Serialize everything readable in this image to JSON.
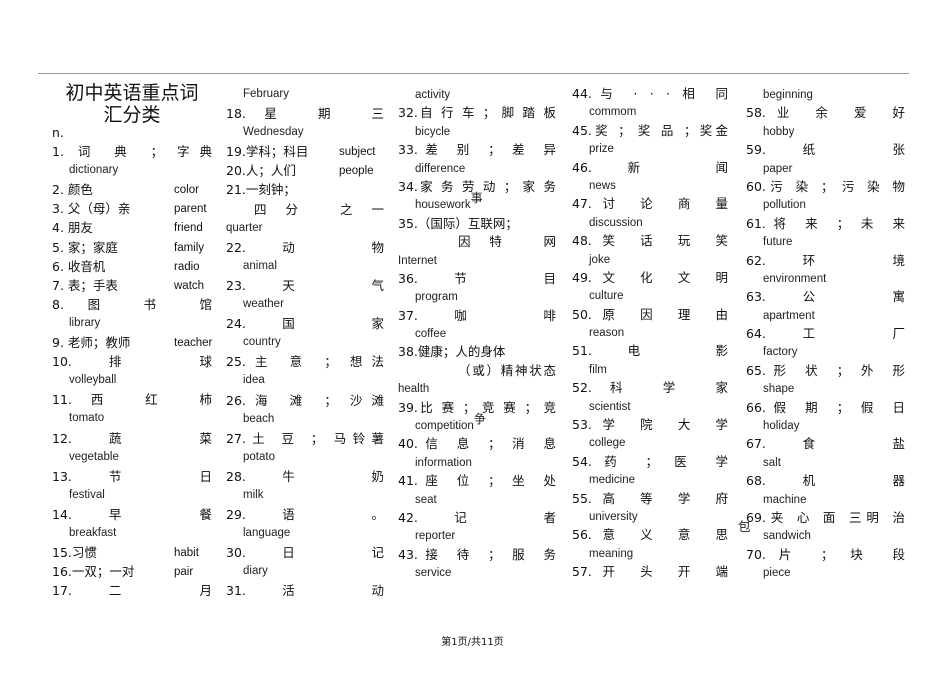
{
  "title": [
    "初中英语重点词",
    "汇分类"
  ],
  "footer": "第1页/共11页",
  "columns": [
    {
      "lines": [
        {
          "k": "l",
          "t": "n."
        },
        {
          "k": "j",
          "t": "1. 词 典 ； 字典"
        },
        {
          "k": "e",
          "t": "dictionary"
        },
        {
          "k": "p",
          "t": "2. 颜色",
          "en": "color"
        },
        {
          "k": "p",
          "t": "3. 父（母）亲",
          "en": "parent"
        },
        {
          "k": "p",
          "t": "4. 朋友",
          "en": "friend"
        },
        {
          "k": "p",
          "t": "5. 家；家庭",
          "en": "family"
        },
        {
          "k": "p",
          "t": "6. 收音机",
          "en": "radio"
        },
        {
          "k": "p",
          "t": "7. 表；手表",
          "en": "watch"
        },
        {
          "k": "j",
          "t": "8. 图 书 馆"
        },
        {
          "k": "e",
          "t": "library"
        },
        {
          "k": "p",
          "t": "9. 老师；教师",
          "en": "teacher"
        },
        {
          "k": "j",
          "t": "10.排 球"
        },
        {
          "k": "e",
          "t": "volleyball"
        },
        {
          "k": "j",
          "t": "11.西 红 柿"
        },
        {
          "k": "e",
          "t": "tomato"
        },
        {
          "k": "j",
          "t": "12.蔬 菜"
        },
        {
          "k": "e",
          "t": "vegetable"
        },
        {
          "k": "j",
          "t": "13.节 日"
        },
        {
          "k": "e",
          "t": "festival"
        },
        {
          "k": "j",
          "t": "14.早 餐"
        },
        {
          "k": "e",
          "t": "breakfast"
        },
        {
          "k": "p",
          "t": "15.习惯",
          "en": "habit"
        },
        {
          "k": "p",
          "t": "16.一双；一对",
          "en": "pair"
        },
        {
          "k": "j",
          "t": "17.二 月"
        }
      ]
    },
    {
      "lines": [
        {
          "k": "e",
          "t": "February"
        },
        {
          "k": "j",
          "t": "18.星 期 三"
        },
        {
          "k": "e",
          "t": "Wednesday"
        },
        {
          "k": "p",
          "t": "19.学科；科目",
          "en": "subject"
        },
        {
          "k": "p",
          "t": "20.人；人们",
          "en": "people"
        },
        {
          "k": "l",
          "t": "21.一刻钟；"
        },
        {
          "k": "ji",
          "t": "四分 之一"
        },
        {
          "k": "e0",
          "t": "quarter"
        },
        {
          "k": "j",
          "t": "22.动 物"
        },
        {
          "k": "e",
          "t": "animal"
        },
        {
          "k": "j",
          "t": "23.天 气"
        },
        {
          "k": "e",
          "t": "weather"
        },
        {
          "k": "j",
          "t": "24.国 家"
        },
        {
          "k": "e",
          "t": "country"
        },
        {
          "k": "j",
          "t": "25.主 意 ； 想法"
        },
        {
          "k": "e",
          "t": "idea"
        },
        {
          "k": "j",
          "t": "26.海 滩 ； 沙滩"
        },
        {
          "k": "e",
          "t": "beach"
        },
        {
          "k": "j",
          "t": "27.土 豆 ； 马铃薯"
        },
        {
          "k": "e",
          "t": "potato"
        },
        {
          "k": "j",
          "t": "28.牛 奶"
        },
        {
          "k": "e",
          "t": "milk"
        },
        {
          "k": "j",
          "t": "29.语 。"
        },
        {
          "k": "e",
          "t": "language"
        },
        {
          "k": "j",
          "t": "30.日 记"
        },
        {
          "k": "e",
          "t": "diary"
        },
        {
          "k": "j",
          "t": "31.活 动"
        }
      ]
    },
    {
      "lines": [
        {
          "k": "e",
          "t": "activity"
        },
        {
          "k": "j",
          "t": "32.自 行 车 ； 脚 踏 板"
        },
        {
          "k": "e",
          "t": "bicycle"
        },
        {
          "k": "j",
          "t": "33.差 别 ； 差 异"
        },
        {
          "k": "e",
          "t": "difference"
        },
        {
          "k": "j",
          "t": "34.家 务 劳 动 ； 家 务"
        },
        {
          "k": "e",
          "t": "housework",
          "x": "事"
        },
        {
          "k": "l",
          "t": "35.（国际）互联网；"
        },
        {
          "k": "jr",
          "t": "因特 网"
        },
        {
          "k": "e0",
          "t": "Internet"
        },
        {
          "k": "j",
          "t": "36.节 目"
        },
        {
          "k": "e",
          "t": "program"
        },
        {
          "k": "j",
          "t": "37.咖 啡"
        },
        {
          "k": "e",
          "t": "coffee"
        },
        {
          "k": "l",
          "t": "38.健康；人的身体"
        },
        {
          "k": "jr",
          "t": "（或）精神状态"
        },
        {
          "k": "e0",
          "t": "health"
        },
        {
          "k": "j",
          "t": "39.比 赛 ； 竞 赛 ； 竞"
        },
        {
          "k": "e",
          "t": "competition",
          "x": "争"
        },
        {
          "k": "j",
          "t": "40.信 息 ； 消 息"
        },
        {
          "k": "e",
          "t": "information"
        },
        {
          "k": "j",
          "t": "41.座 位 ； 坐 处"
        },
        {
          "k": "e",
          "t": "seat"
        },
        {
          "k": "j",
          "t": "42.记 者"
        },
        {
          "k": "e",
          "t": "reporter"
        },
        {
          "k": "j",
          "t": "43.接 待 ； 服 务"
        },
        {
          "k": "e",
          "t": "service"
        }
      ]
    },
    {
      "lines": [
        {
          "k": "j",
          "t": "44.与 · · · 相 同"
        },
        {
          "k": "e",
          "t": "commom"
        },
        {
          "k": "j",
          "t": "45.奖 ； 奖 品 ；奖金"
        },
        {
          "k": "e",
          "t": "prize"
        },
        {
          "k": "j",
          "t": "46.新 闻"
        },
        {
          "k": "e",
          "t": "news"
        },
        {
          "k": "j",
          "t": "47.讨 论 商 量"
        },
        {
          "k": "e",
          "t": "discussion"
        },
        {
          "k": "j",
          "t": "48.笑 话 玩 笑"
        },
        {
          "k": "e",
          "t": "joke"
        },
        {
          "k": "j",
          "t": "49.文 化 文 明"
        },
        {
          "k": "e",
          "t": "culture"
        },
        {
          "k": "j",
          "t": "50.原 因 理 由"
        },
        {
          "k": "e",
          "t": "reason"
        },
        {
          "k": "j",
          "t": "51.电 影"
        },
        {
          "k": "e",
          "t": "film"
        },
        {
          "k": "j",
          "t": "52.科 学 家"
        },
        {
          "k": "e",
          "t": "scientist"
        },
        {
          "k": "j",
          "t": "53.学 院 大 学"
        },
        {
          "k": "e",
          "t": "college"
        },
        {
          "k": "j",
          "t": "54.药 ； 医 学"
        },
        {
          "k": "e",
          "t": "medicine"
        },
        {
          "k": "j",
          "t": "55.高 等 学 府"
        },
        {
          "k": "e",
          "t": "university"
        },
        {
          "k": "j",
          "t": "56.意 义 意 思"
        },
        {
          "k": "e",
          "t": "meaning"
        },
        {
          "k": "j",
          "t": "57.开 头 开 端"
        }
      ]
    },
    {
      "lines": [
        {
          "k": "e",
          "t": "beginning"
        },
        {
          "k": "j",
          "t": "58.业 余 爱 好"
        },
        {
          "k": "e",
          "t": "hobby"
        },
        {
          "k": "j",
          "t": "59.纸 张"
        },
        {
          "k": "e",
          "t": "paper"
        },
        {
          "k": "j",
          "t": "60.污 染 ； 污 染 物"
        },
        {
          "k": "e",
          "t": "pollution"
        },
        {
          "k": "j",
          "t": "61.将 来 ； 未 来"
        },
        {
          "k": "e",
          "t": "future"
        },
        {
          "k": "j",
          "t": "62.环 境"
        },
        {
          "k": "e",
          "t": "environment"
        },
        {
          "k": "j",
          "t": "63.公 寓"
        },
        {
          "k": "e",
          "t": "apartment"
        },
        {
          "k": "j",
          "t": "64.工 厂"
        },
        {
          "k": "e",
          "t": "factory"
        },
        {
          "k": "j",
          "t": "65.形 状 ； 外 形"
        },
        {
          "k": "e",
          "t": "shape"
        },
        {
          "k": "j",
          "t": "66.假 期 ； 假 日"
        },
        {
          "k": "e",
          "t": "holiday"
        },
        {
          "k": "j",
          "t": "67.食 盐"
        },
        {
          "k": "e",
          "t": "salt"
        },
        {
          "k": "j",
          "t": "68.机 器"
        },
        {
          "k": "e",
          "t": "machine"
        },
        {
          "k": "j",
          "t": "69.夹 心 面 三明 治"
        },
        {
          "k": "e",
          "t": "sandwich",
          "lead": "包"
        },
        {
          "k": "j",
          "t": "70.片 ； 块 段"
        },
        {
          "k": "e",
          "t": "piece"
        }
      ]
    }
  ]
}
